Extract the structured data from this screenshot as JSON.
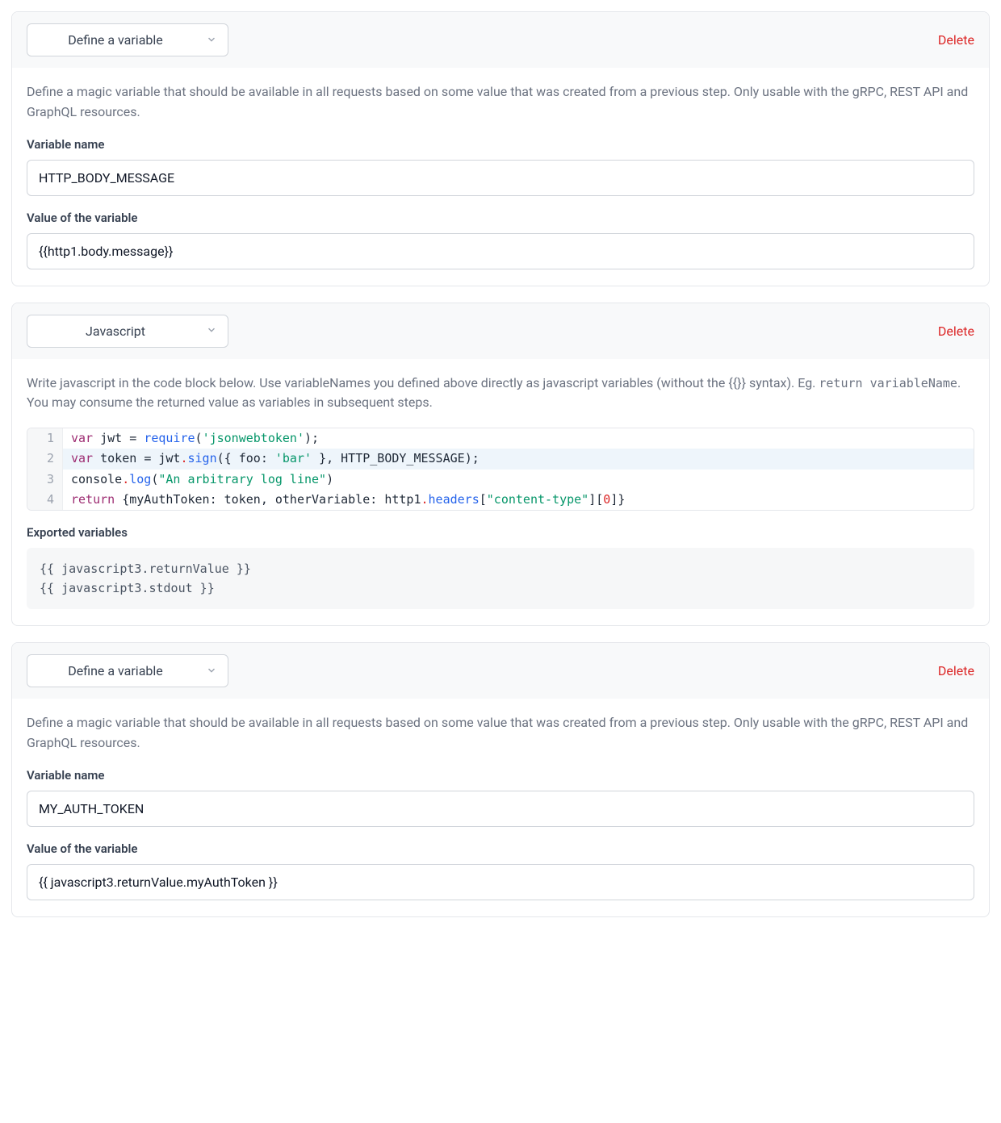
{
  "common": {
    "delete_label": "Delete",
    "var_name_label": "Variable name",
    "var_value_label": "Value of the variable"
  },
  "step1": {
    "type_label": "Define a variable",
    "help": "Define a magic variable that should be available in all requests based on some value that was created from a previous step. Only usable with the gRPC, REST API and GraphQL resources.",
    "var_name_value": "HTTP_BODY_MESSAGE",
    "var_value_value": "{{http1.body.message}}"
  },
  "step2": {
    "type_label": "Javascript",
    "help_pre": "Write javascript in the code block below. Use variableNames you defined above directly as javascript variables (without the {{}} syntax). Eg. ",
    "help_code": "return variableName",
    "help_post": ". You may consume the returned value as variables in subsequent steps.",
    "code_lines": [
      "var jwt = require('jsonwebtoken');",
      "var token = jwt.sign({ foo: 'bar' }, HTTP_BODY_MESSAGE);",
      "console.log(\"An arbitrary log line\")",
      "return {myAuthToken: token, otherVariable: http1.headers[\"content-type\"][0]}"
    ],
    "highlighted_line_index": 1,
    "exported_label": "Exported variables",
    "exported_vars": "{{ javascript3.returnValue }}\n{{ javascript3.stdout }}"
  },
  "step3": {
    "type_label": "Define a variable",
    "help": "Define a magic variable that should be available in all requests based on some value that was created from a previous step. Only usable with the gRPC, REST API and GraphQL resources.",
    "var_name_value": "MY_AUTH_TOKEN",
    "var_value_value": "{{ javascript3.returnValue.myAuthToken }}"
  }
}
